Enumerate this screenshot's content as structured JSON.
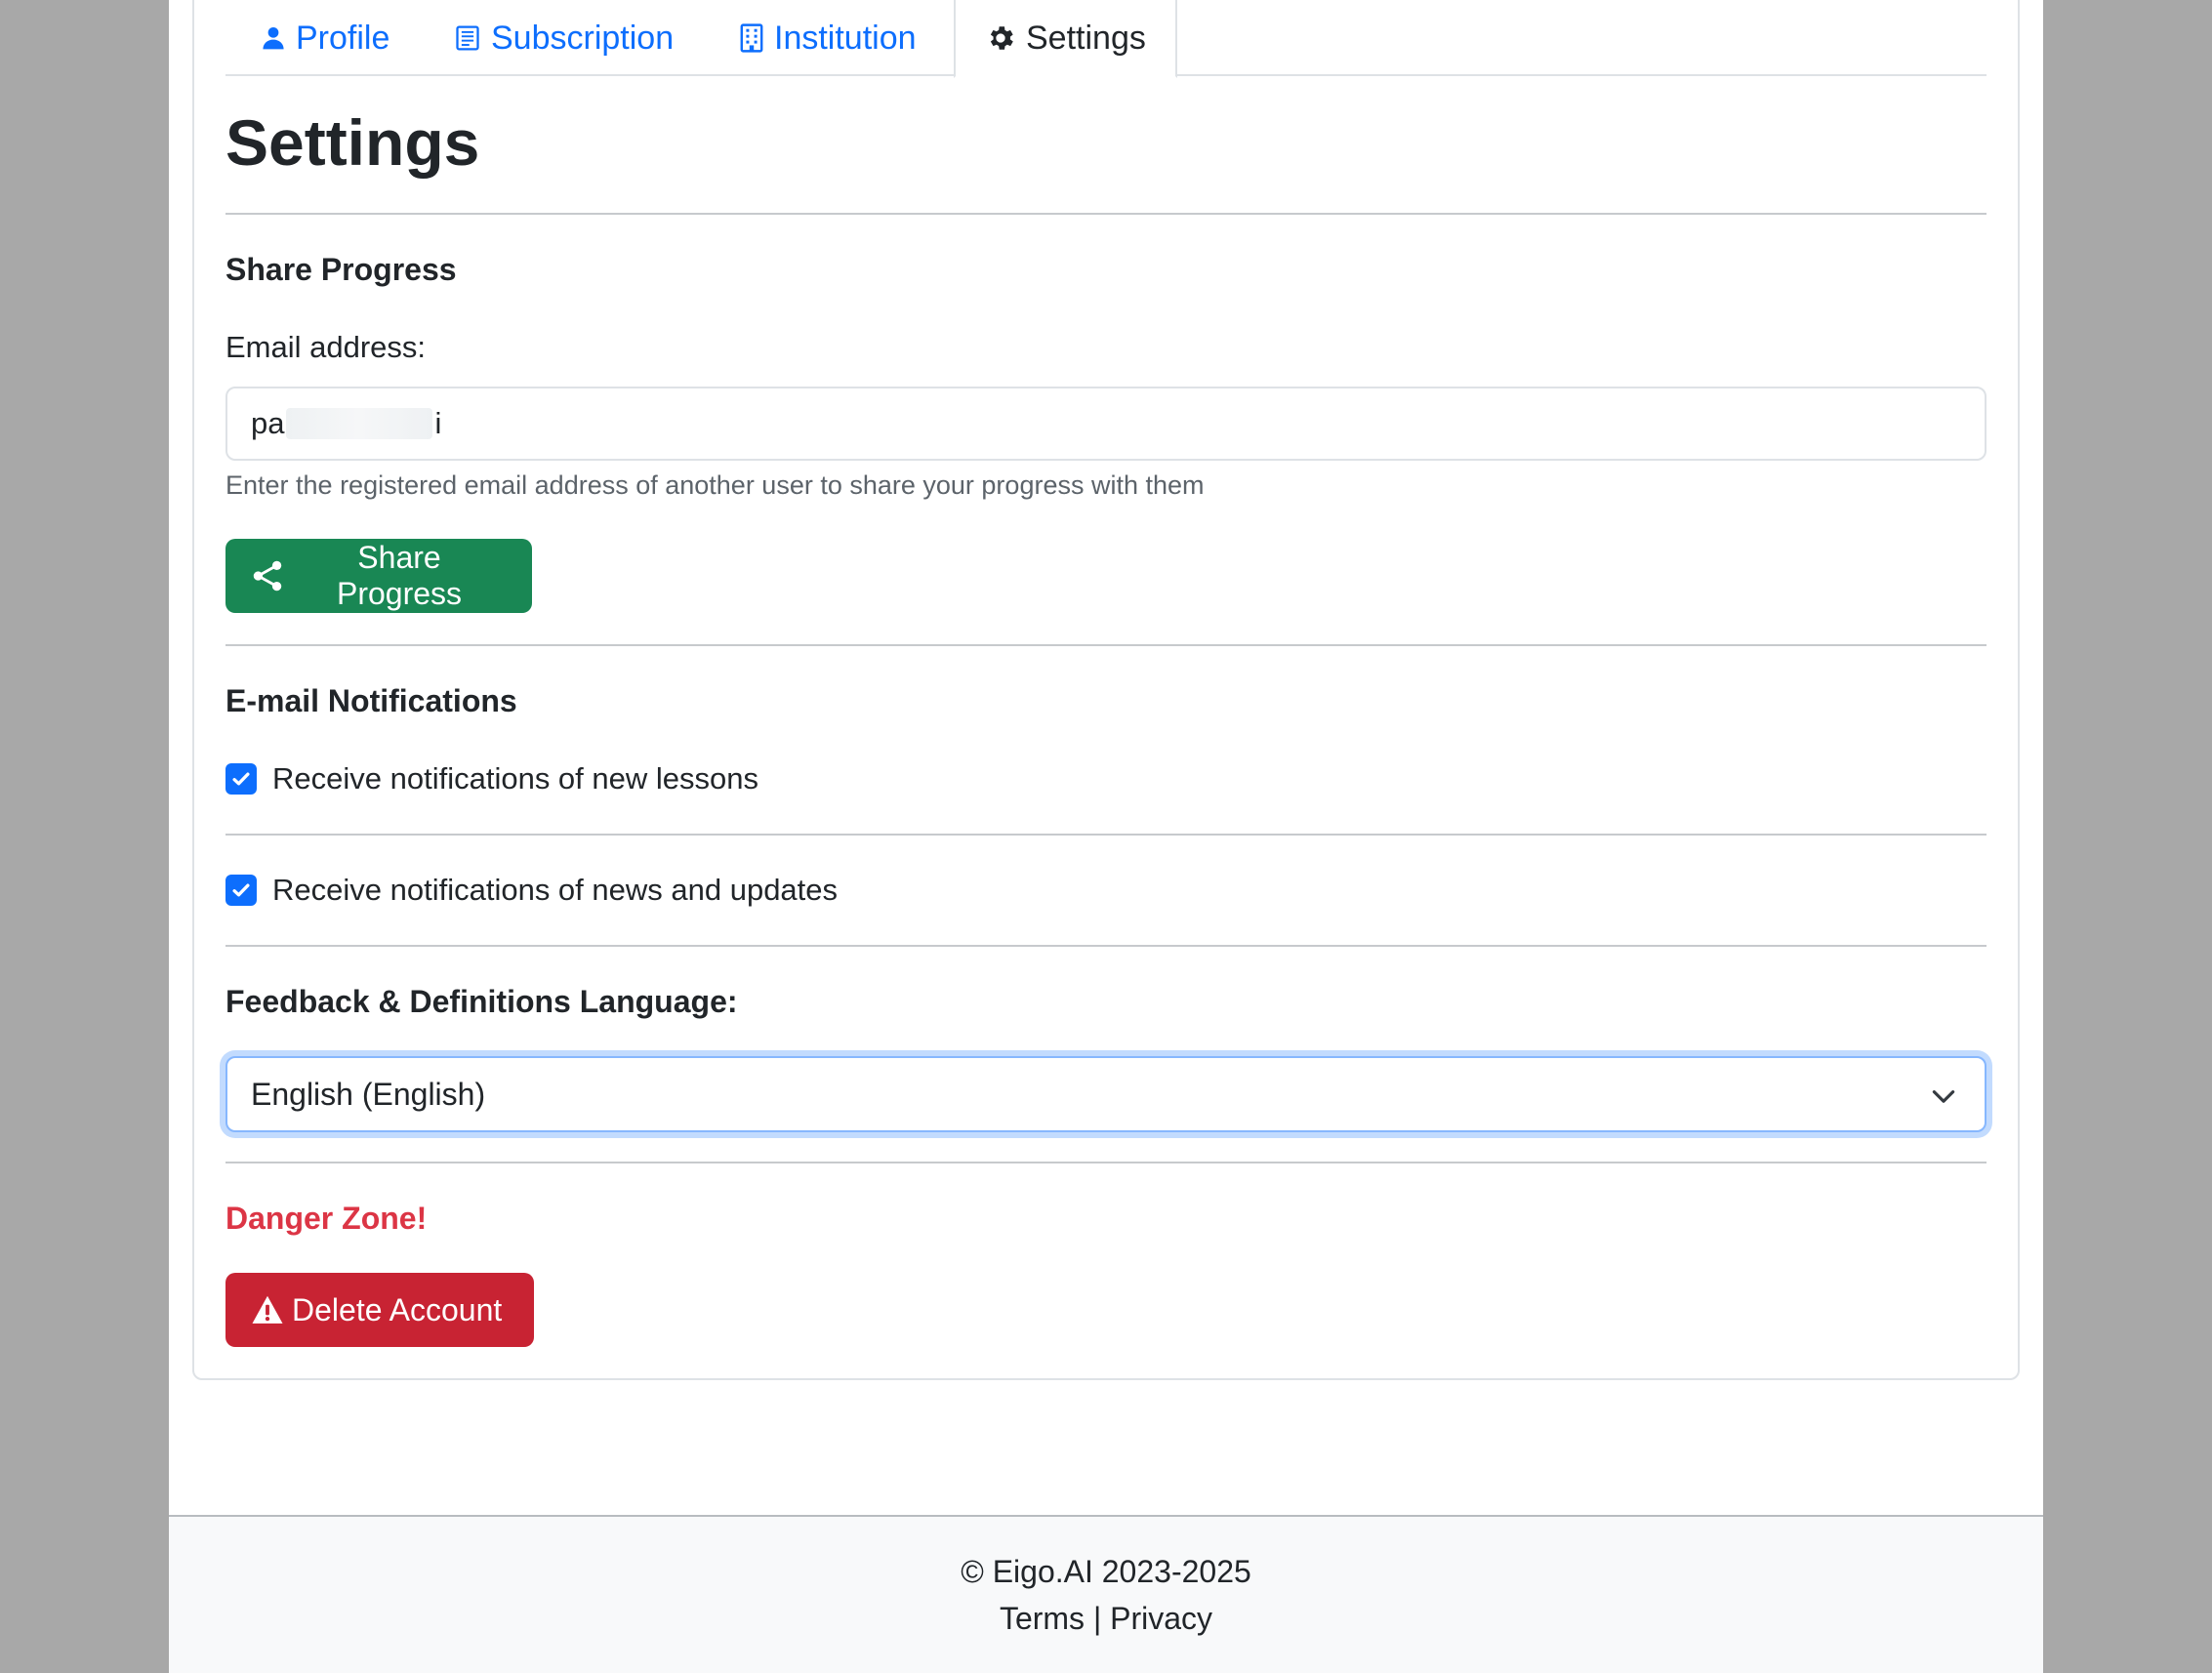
{
  "tabs": [
    {
      "label": "Profile",
      "icon": "person-icon",
      "active": false
    },
    {
      "label": "Subscription",
      "icon": "receipt-icon",
      "active": false
    },
    {
      "label": "Institution",
      "icon": "building-icon",
      "active": false
    },
    {
      "label": "Settings",
      "icon": "gear-icon",
      "active": true
    }
  ],
  "page_title": "Settings",
  "share": {
    "heading": "Share Progress",
    "email_label": "Email address:",
    "email_value_start": "pa",
    "email_value_end": "i",
    "help": "Enter the registered email address of another user to share your progress with them",
    "button_label": "Share Progress"
  },
  "notifications": {
    "heading": "E-mail Notifications",
    "items": [
      {
        "label": "Receive notifications of new lessons",
        "checked": true
      },
      {
        "label": "Receive notifications of news and updates",
        "checked": true
      }
    ]
  },
  "language": {
    "heading": "Feedback & Definitions Language:",
    "selected": "English (English)"
  },
  "danger": {
    "heading": "Danger Zone!",
    "button_label": "Delete Account"
  },
  "footer": {
    "copyright": "© Eigo.AI 2023-2025",
    "terms": "Terms",
    "separator": " | ",
    "privacy": "Privacy"
  },
  "colors": {
    "primary": "#0d6efd",
    "success": "#198754",
    "danger": "#dc3545",
    "backdrop": "#a8a8a8"
  }
}
